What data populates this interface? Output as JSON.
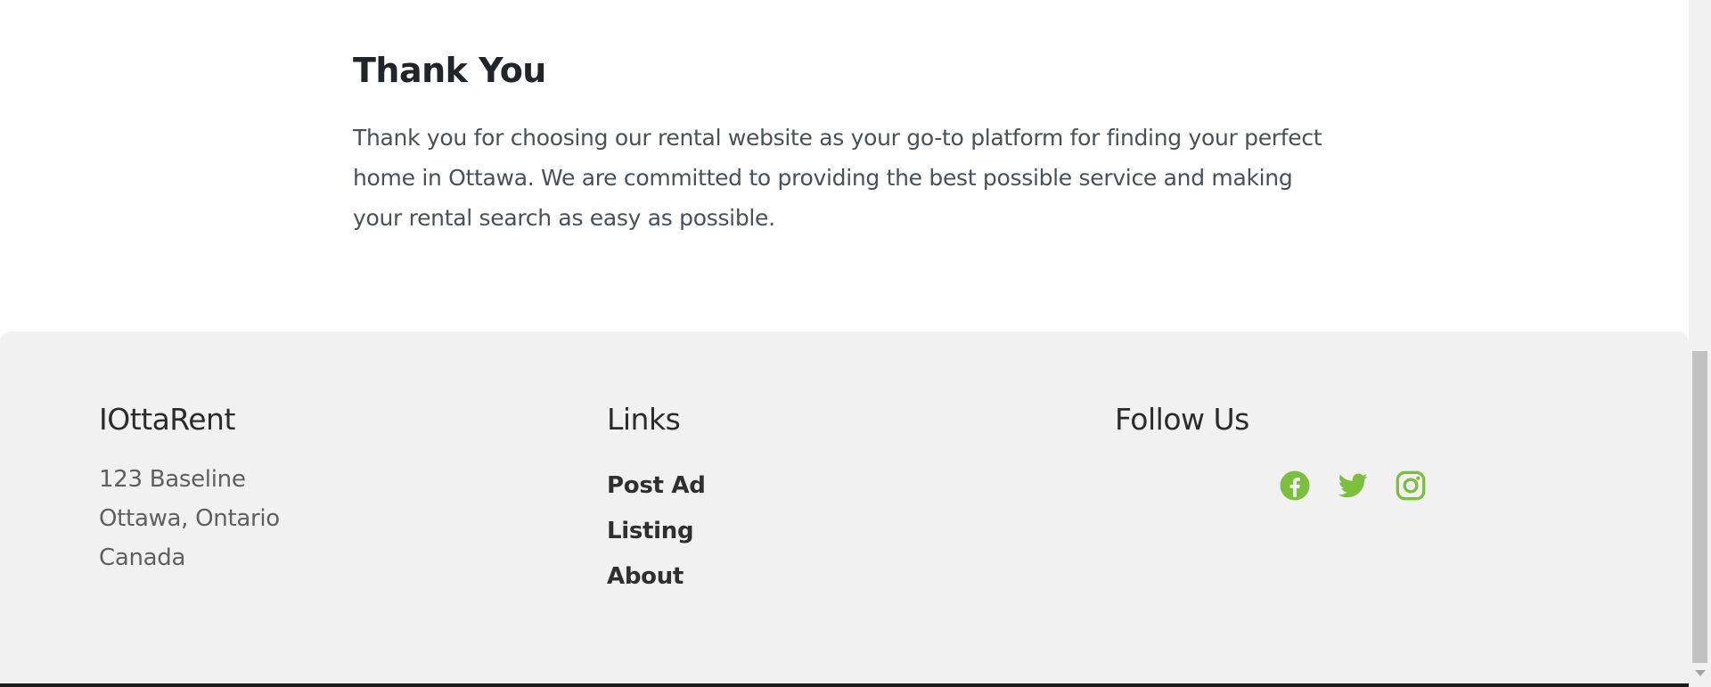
{
  "thank_you": {
    "heading": "Thank You",
    "body": "Thank you for choosing our rental website as your go-to platform for finding your perfect home in Ottawa. We are committed to providing the best possible service and making your rental search as easy as possible."
  },
  "footer": {
    "brand": {
      "title": "IOttaRent",
      "address": [
        "123 Baseline",
        "Ottawa, Ontario",
        "Canada"
      ]
    },
    "links": {
      "title": "Links",
      "items": [
        "Post Ad",
        "Listing",
        "About"
      ]
    },
    "social": {
      "title": "Follow Us",
      "icons": [
        "facebook-icon",
        "twitter-icon",
        "instagram-icon"
      ],
      "accent_color": "#7cbf3d"
    },
    "background_color": "#f1f1f1"
  }
}
